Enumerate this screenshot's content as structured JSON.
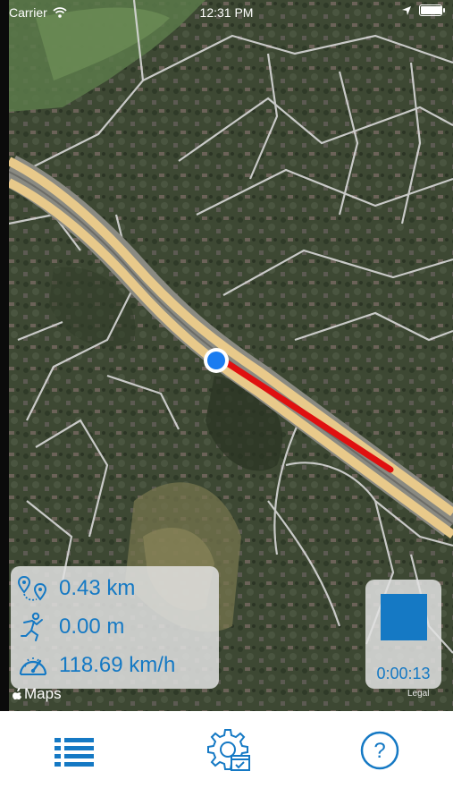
{
  "status_bar": {
    "carrier": "Carrier",
    "time": "12:31 PM",
    "battery_level": 1.0
  },
  "map": {
    "attribution": "Maps",
    "legal_label": "Legal",
    "icons": [
      "current-location-dot",
      "route-track"
    ]
  },
  "stats": {
    "distance": "0.43 km",
    "altitude": "0.00 m",
    "speed": "118.69 km/h",
    "icons": [
      "route-pins-icon",
      "altitude-icon",
      "speedometer-icon"
    ]
  },
  "recording": {
    "timer": "0:00:13",
    "icon": "stop-icon"
  },
  "tab_bar": {
    "items": [
      {
        "icon": "list-icon"
      },
      {
        "icon": "settings-gear-icon"
      },
      {
        "icon": "help-icon"
      }
    ]
  },
  "colors": {
    "accent": "#1579c4",
    "track": "#e01010",
    "road": "#e8c98a",
    "location_dot": "#1a7cf0"
  }
}
